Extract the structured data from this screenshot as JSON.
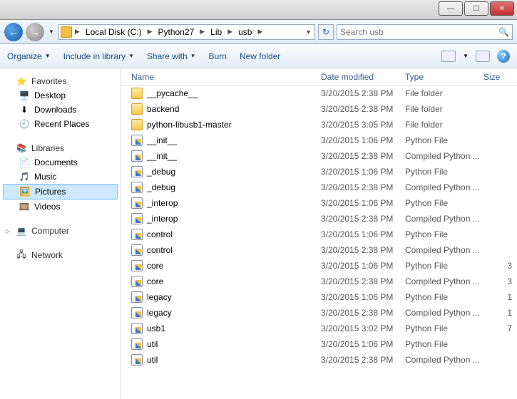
{
  "window": {
    "min": "—",
    "max": "☐",
    "close": "✕"
  },
  "breadcrumb": {
    "segments": [
      "Local Disk (C:)",
      "Python27",
      "Lib",
      "usb"
    ]
  },
  "search": {
    "placeholder": "Search usb"
  },
  "toolbar": {
    "organize": "Organize",
    "include": "Include in library",
    "share": "Share with",
    "burn": "Burn",
    "newfolder": "New folder"
  },
  "sidebar": {
    "favorites": {
      "label": "Favorites",
      "items": [
        {
          "icon": "🖥️",
          "label": "Desktop"
        },
        {
          "icon": "⬇",
          "label": "Downloads"
        },
        {
          "icon": "🕘",
          "label": "Recent Places"
        }
      ]
    },
    "libraries": {
      "label": "Libraries",
      "items": [
        {
          "icon": "📄",
          "label": "Documents"
        },
        {
          "icon": "🎵",
          "label": "Music"
        },
        {
          "icon": "🖼️",
          "label": "Pictures",
          "selected": true
        },
        {
          "icon": "🎞️",
          "label": "Videos"
        }
      ]
    },
    "computer": {
      "label": "Computer"
    },
    "network": {
      "label": "Network"
    }
  },
  "columns": {
    "name": "Name",
    "date": "Date modified",
    "type": "Type",
    "size": "Size"
  },
  "files": [
    {
      "icon": "folder",
      "name": "__pycache__",
      "date": "3/20/2015 2:38 PM",
      "type": "File folder",
      "size": ""
    },
    {
      "icon": "folder",
      "name": "backend",
      "date": "3/20/2015 2:38 PM",
      "type": "File folder",
      "size": ""
    },
    {
      "icon": "folder",
      "name": "python-libusb1-master",
      "date": "3/20/2015 3:05 PM",
      "type": "File folder",
      "size": ""
    },
    {
      "icon": "py",
      "name": "__init__",
      "date": "3/20/2015 1:06 PM",
      "type": "Python File",
      "size": ""
    },
    {
      "icon": "py",
      "name": "__init__",
      "date": "3/20/2015 2:38 PM",
      "type": "Compiled Python ...",
      "size": ""
    },
    {
      "icon": "py",
      "name": "_debug",
      "date": "3/20/2015 1:06 PM",
      "type": "Python File",
      "size": ""
    },
    {
      "icon": "py",
      "name": "_debug",
      "date": "3/20/2015 2:38 PM",
      "type": "Compiled Python ...",
      "size": ""
    },
    {
      "icon": "py",
      "name": "_interop",
      "date": "3/20/2015 1:06 PM",
      "type": "Python File",
      "size": ""
    },
    {
      "icon": "py",
      "name": "_interop",
      "date": "3/20/2015 2:38 PM",
      "type": "Compiled Python ...",
      "size": ""
    },
    {
      "icon": "py",
      "name": "control",
      "date": "3/20/2015 1:06 PM",
      "type": "Python File",
      "size": ""
    },
    {
      "icon": "py",
      "name": "control",
      "date": "3/20/2015 2:38 PM",
      "type": "Compiled Python ...",
      "size": ""
    },
    {
      "icon": "py",
      "name": "core",
      "date": "3/20/2015 1:06 PM",
      "type": "Python File",
      "size": "3"
    },
    {
      "icon": "py",
      "name": "core",
      "date": "3/20/2015 2:38 PM",
      "type": "Compiled Python ...",
      "size": "3"
    },
    {
      "icon": "py",
      "name": "legacy",
      "date": "3/20/2015 1:06 PM",
      "type": "Python File",
      "size": "1"
    },
    {
      "icon": "py",
      "name": "legacy",
      "date": "3/20/2015 2:38 PM",
      "type": "Compiled Python ...",
      "size": "1"
    },
    {
      "icon": "py",
      "name": "usb1",
      "date": "3/20/2015 3:02 PM",
      "type": "Python File",
      "size": "7"
    },
    {
      "icon": "py",
      "name": "util",
      "date": "3/20/2015 1:06 PM",
      "type": "Python File",
      "size": ""
    },
    {
      "icon": "py",
      "name": "util",
      "date": "3/20/2015 2:38 PM",
      "type": "Compiled Python ...",
      "size": ""
    }
  ]
}
